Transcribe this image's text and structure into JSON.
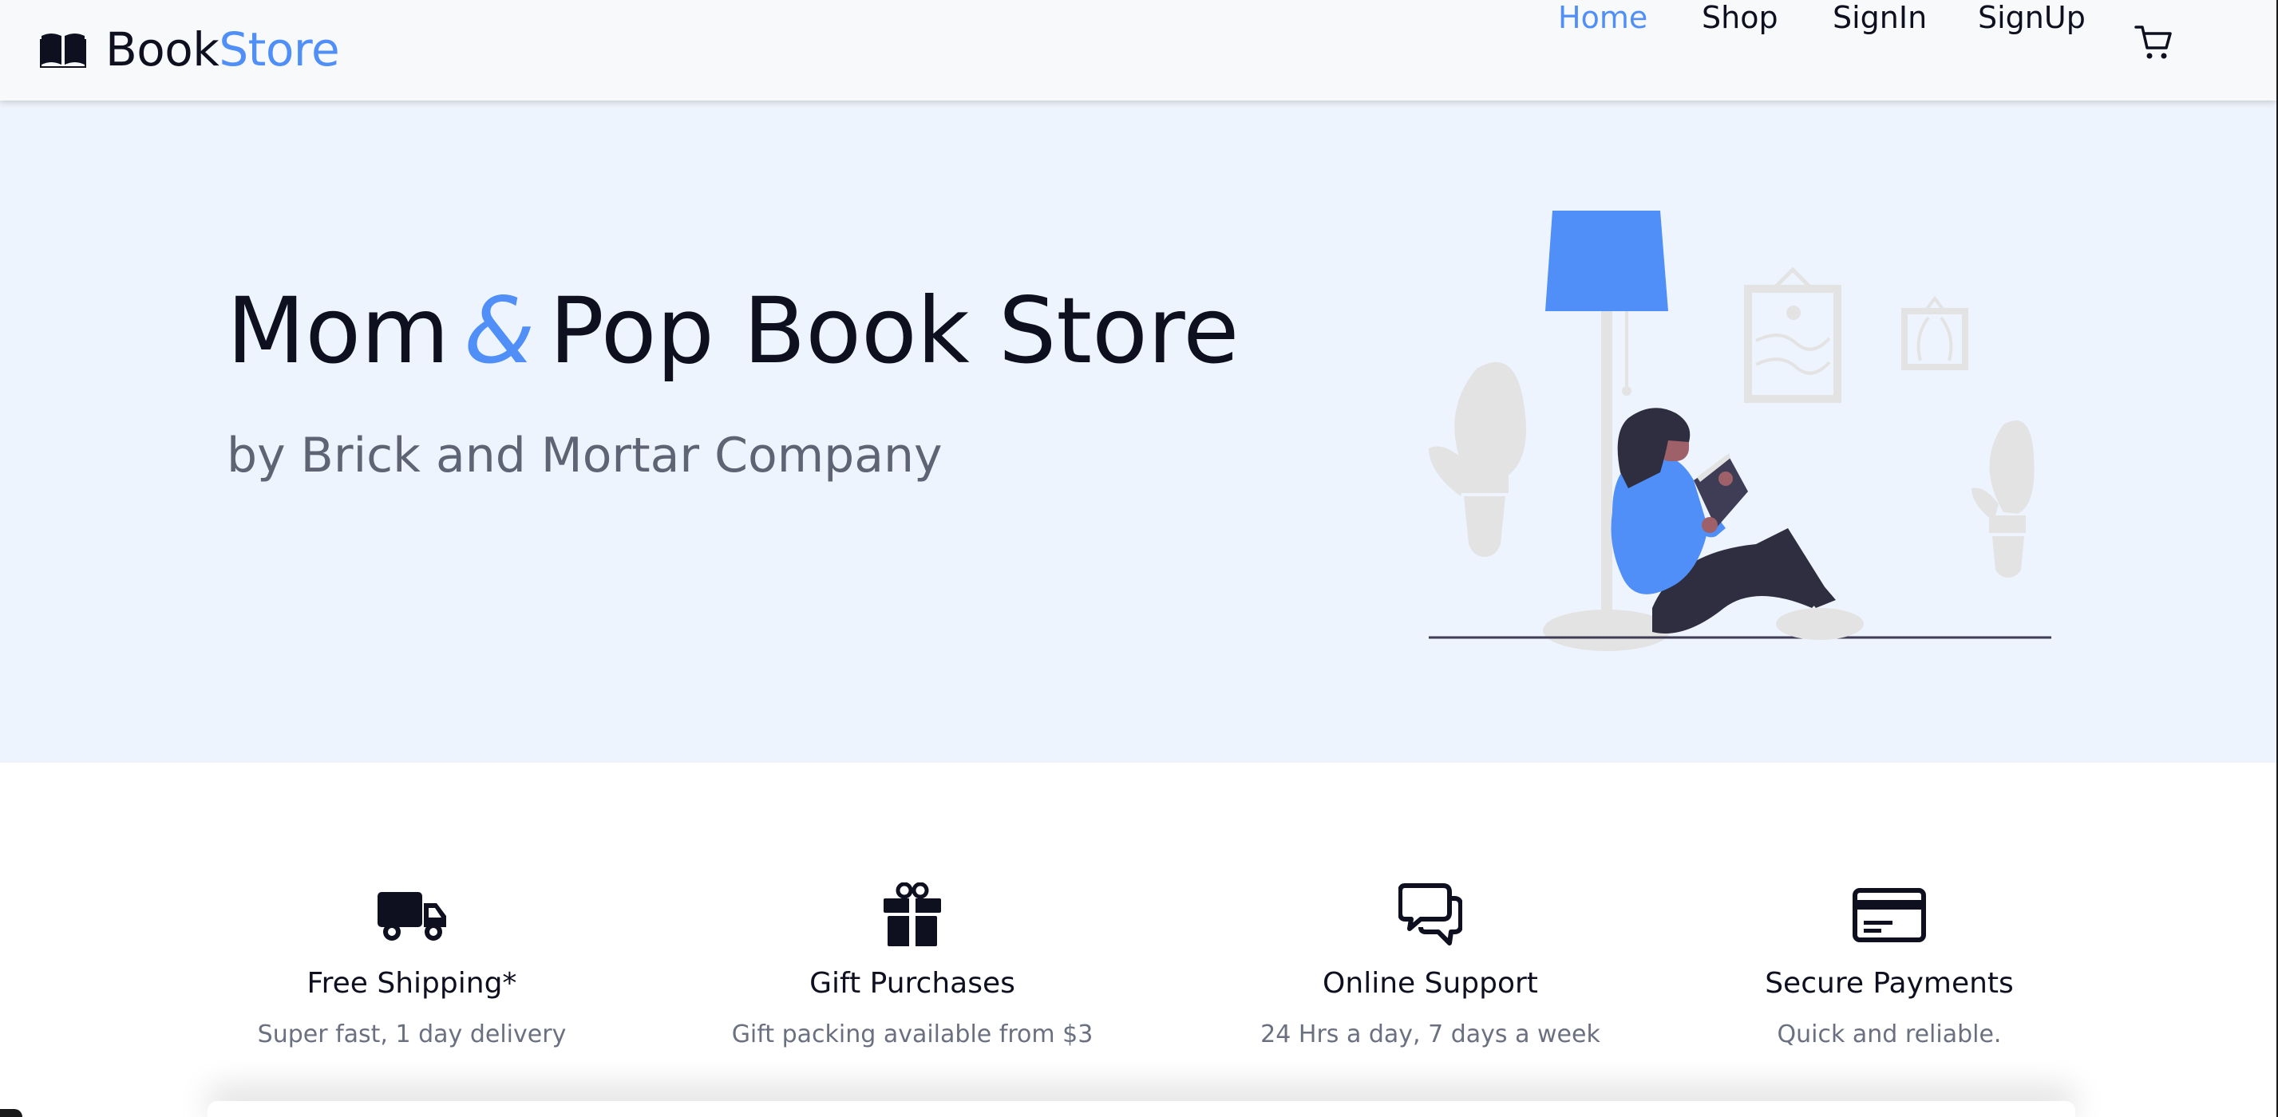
{
  "brand": {
    "prefix": "Book",
    "accent": "Store",
    "accent_color": "#4f8ff7"
  },
  "nav": {
    "items": [
      {
        "label": "Home",
        "active": true
      },
      {
        "label": "Shop",
        "active": false
      },
      {
        "label": "SignIn",
        "active": false
      },
      {
        "label": "SignUp",
        "active": false
      }
    ],
    "cart_icon": "cart-icon"
  },
  "hero": {
    "title_part1": "Mom",
    "title_amp": "&",
    "title_part2": "Pop Book Store",
    "subtitle": "by Brick and Mortar Company",
    "background": "#eef4fd",
    "illustration": "woman-reading-under-lamp"
  },
  "features": [
    {
      "icon": "truck-icon",
      "title": "Free Shipping*",
      "desc": "Super fast, 1 day delivery"
    },
    {
      "icon": "gift-icon",
      "title": "Gift Purchases",
      "desc": "Gift packing available from $3"
    },
    {
      "icon": "chat-icon",
      "title": "Online Support",
      "desc": "24 Hrs a day, 7 days a week"
    },
    {
      "icon": "credit-card-icon",
      "title": "Secure Payments",
      "desc": "Quick and reliable."
    }
  ]
}
